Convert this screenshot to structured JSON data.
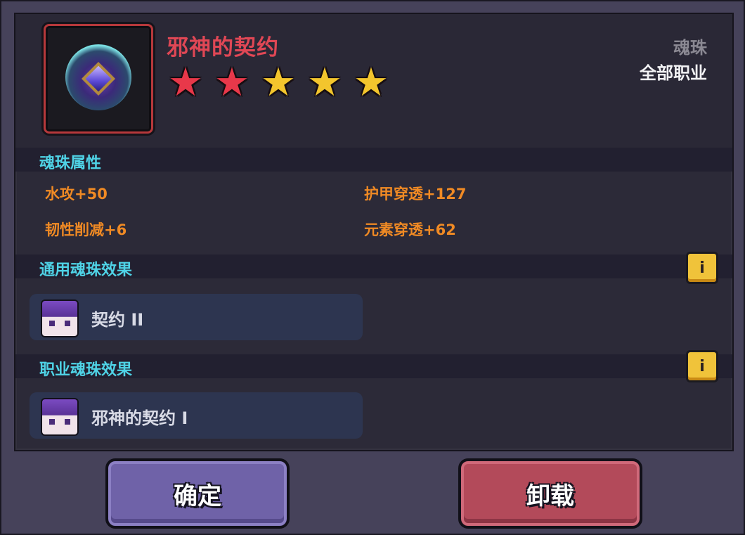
{
  "item": {
    "name": "邪神的契约",
    "type": "魂珠",
    "class": "全部职业",
    "stars": [
      {
        "color": "#e8384a"
      },
      {
        "color": "#e8384a"
      },
      {
        "color": "#f3c52d"
      },
      {
        "color": "#f3c52d"
      },
      {
        "color": "#f3c52d"
      }
    ],
    "icon": "soul-orb-icon"
  },
  "attributes": {
    "title": "魂珠属性",
    "list": [
      "水攻+50",
      "护甲穿透+127",
      "韧性削减+6",
      "元素穿透+62"
    ]
  },
  "general_effect": {
    "title": "通用魂珠效果",
    "label": "契约 II"
  },
  "class_effect": {
    "title": "职业魂珠效果",
    "label": "邪神的契约 I"
  },
  "buttons": {
    "confirm": "确定",
    "unequip": "卸载",
    "info_glyph": "i"
  },
  "colors": {
    "title": "#e04755",
    "section": "#4fd3e6",
    "attribute": "#f08a24",
    "confirm": "#6f62a8",
    "unequip": "#b34a5a"
  }
}
